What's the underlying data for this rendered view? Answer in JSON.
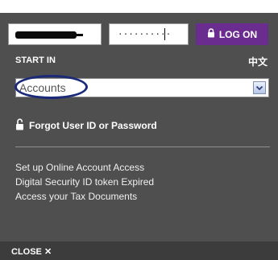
{
  "login": {
    "password_value": "··········",
    "logon_label": "LOG ON",
    "start_in_label": "START IN",
    "language_link": "中文",
    "selected_account": "Accounts",
    "forgot_label": "Forgot User ID or Password",
    "links": [
      "Set up Online Account Access",
      "Digital Security ID token Expired",
      "Access your Tax Documents"
    ],
    "close_label": "CLOSE ✕"
  },
  "colors": {
    "panel": "#4f4f4f",
    "logon_button": "#6a2d8f",
    "annotation_oval": "#1a2a78"
  }
}
